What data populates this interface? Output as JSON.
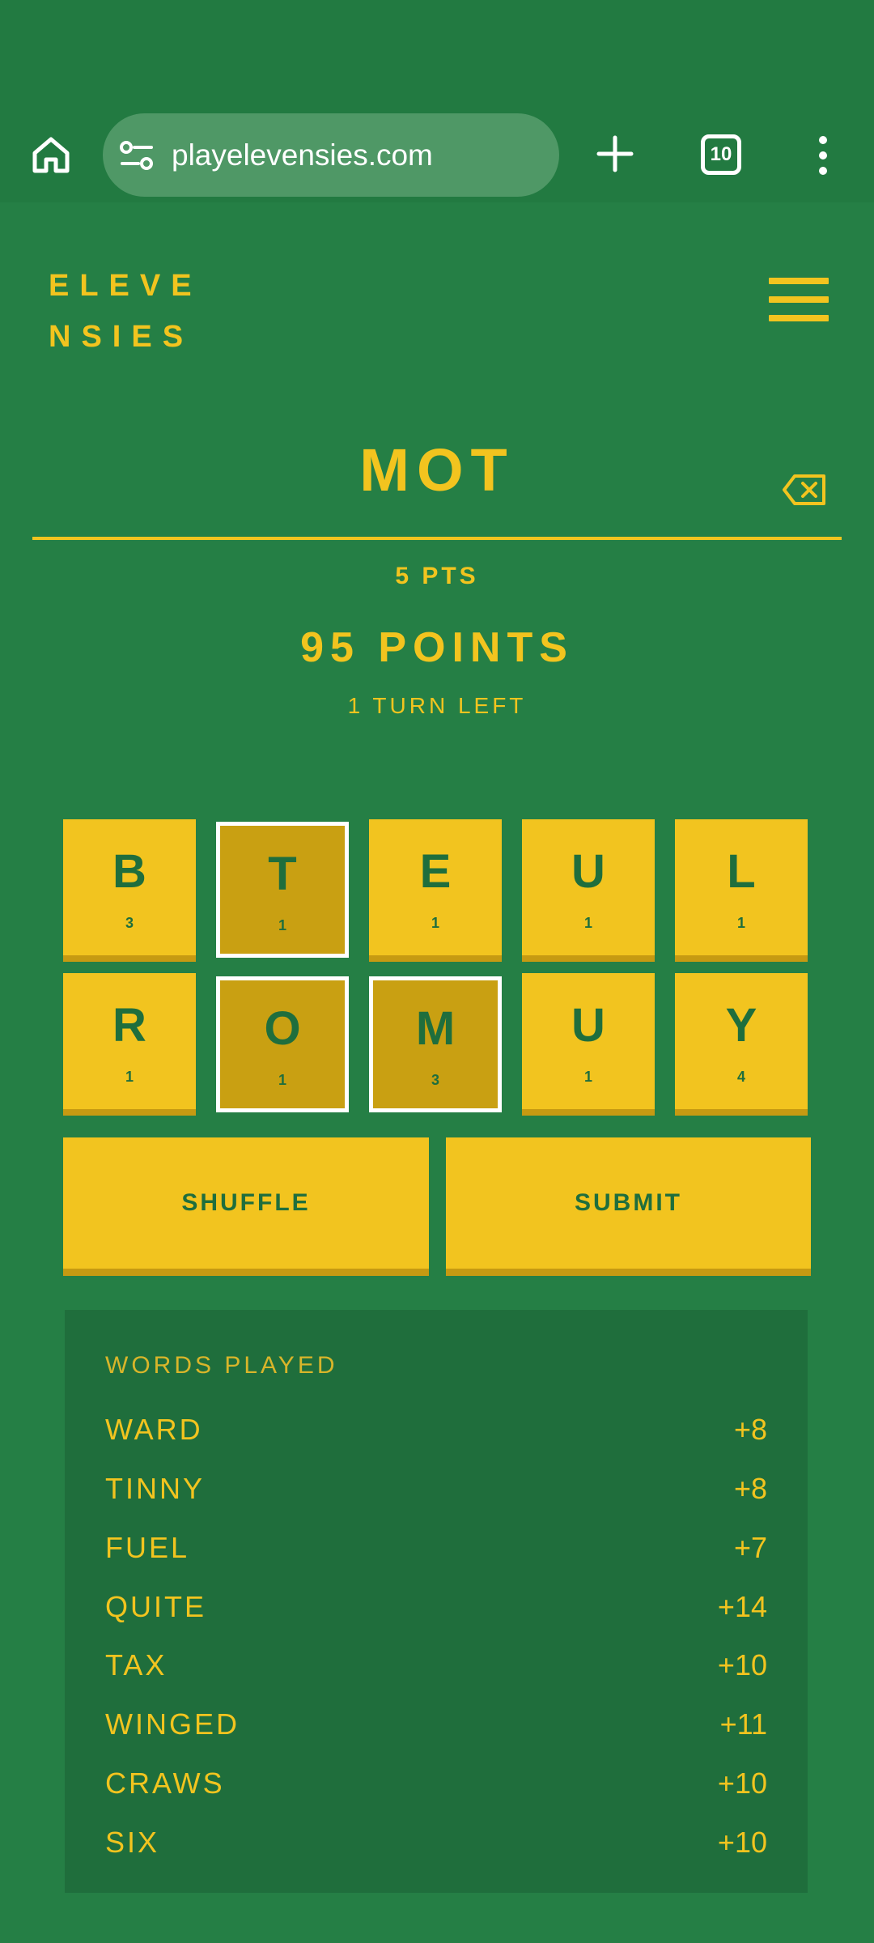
{
  "browser": {
    "url": "playelevensies.com",
    "tab_count": "10",
    "icons": [
      "home-icon",
      "site-settings-icon",
      "plus-icon",
      "tabs-icon",
      "more-vert-icon"
    ]
  },
  "site": {
    "logo_line1": "ELEVE",
    "logo_line2": "NSIES",
    "menu_icon": "hamburger-icon"
  },
  "game": {
    "current_word": "MOT",
    "word_points": "5 PTS",
    "total_points": "95 POINTS",
    "turns_left": "1 TURN LEFT",
    "tiles": [
      {
        "letter": "B",
        "score": "3",
        "selected": false
      },
      {
        "letter": "T",
        "score": "1",
        "selected": true
      },
      {
        "letter": "E",
        "score": "1",
        "selected": false
      },
      {
        "letter": "U",
        "score": "1",
        "selected": false
      },
      {
        "letter": "L",
        "score": "1",
        "selected": false
      },
      {
        "letter": "R",
        "score": "1",
        "selected": false
      },
      {
        "letter": "O",
        "score": "1",
        "selected": true
      },
      {
        "letter": "M",
        "score": "3",
        "selected": true
      },
      {
        "letter": "U",
        "score": "1",
        "selected": false
      },
      {
        "letter": "Y",
        "score": "4",
        "selected": false
      }
    ],
    "shuffle_label": "SHUFFLE",
    "submit_label": "SUBMIT"
  },
  "words_played": {
    "title": "WORDS PLAYED",
    "items": [
      {
        "word": "WARD",
        "score": "+8"
      },
      {
        "word": "TINNY",
        "score": "+8"
      },
      {
        "word": "FUEL",
        "score": "+7"
      },
      {
        "word": "QUITE",
        "score": "+14"
      },
      {
        "word": "TAX",
        "score": "+10"
      },
      {
        "word": "WINGED",
        "score": "+11"
      },
      {
        "word": "CRAWS",
        "score": "+10"
      },
      {
        "word": "SIX",
        "score": "+10"
      }
    ]
  },
  "colors": {
    "background": "#257f45",
    "accent": "#f2c41f",
    "tile_text": "#1f6e3d",
    "selected_tile": "#c9a012"
  }
}
